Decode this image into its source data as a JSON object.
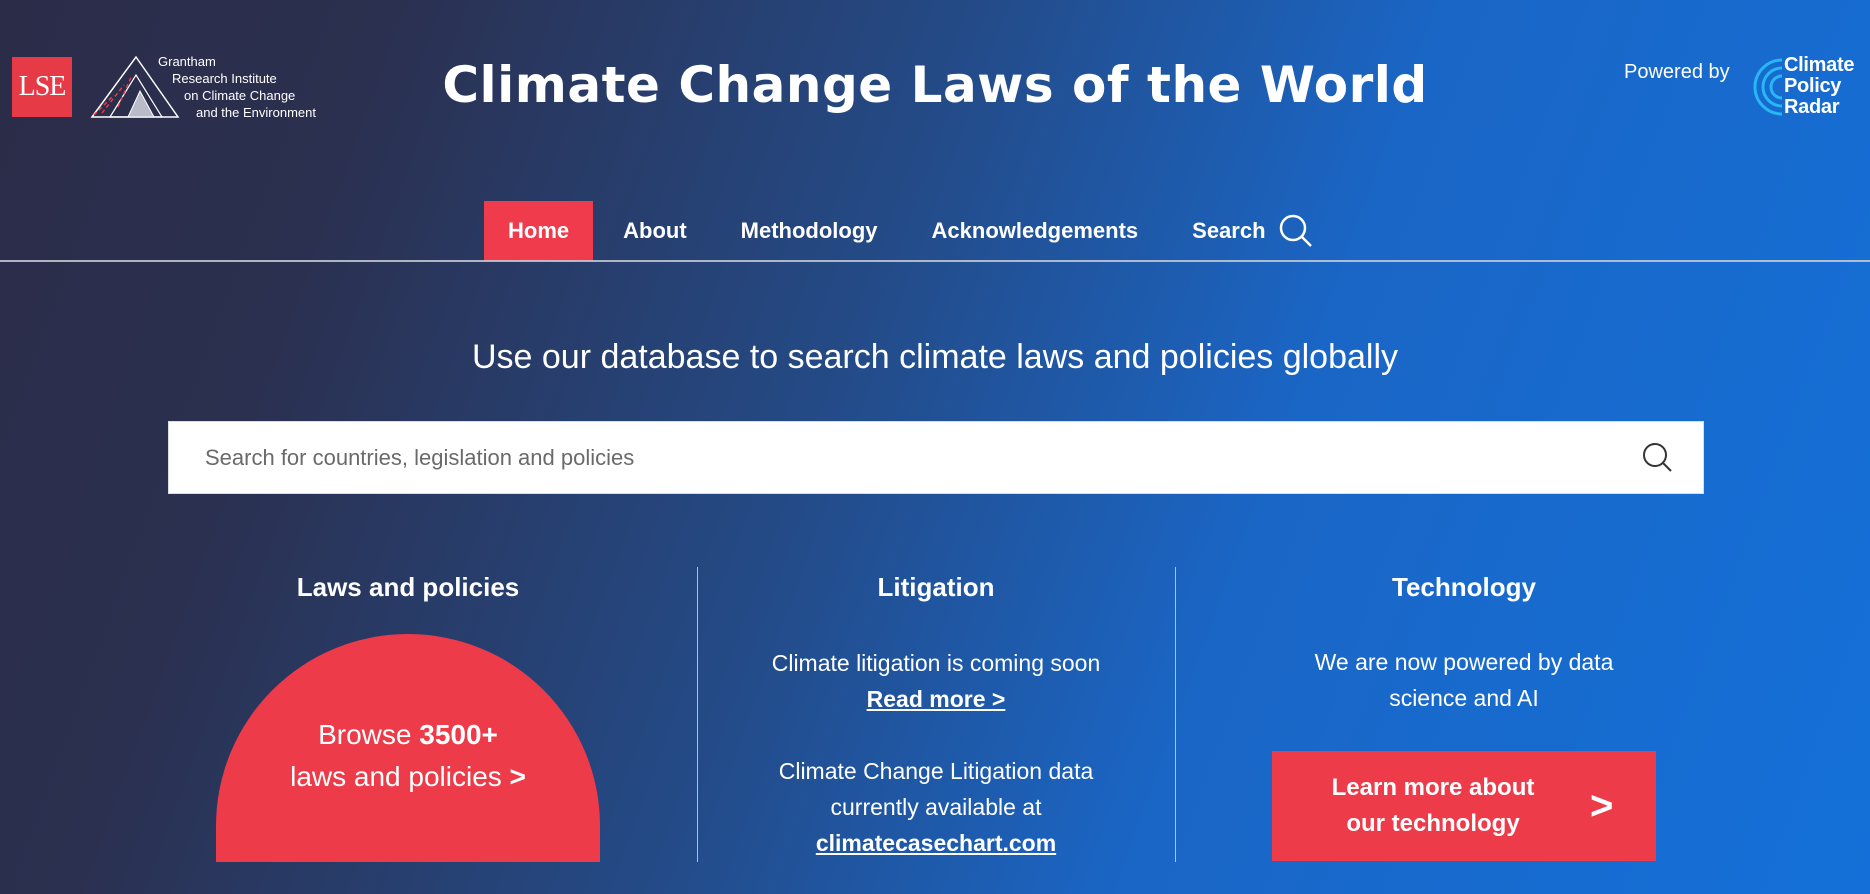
{
  "header": {
    "lse_logo_text": "LSE",
    "institute_lines": [
      "Grantham",
      "Research Institute",
      "on Climate Change",
      "and the Environment"
    ],
    "site_title": "Climate Change Laws of the World",
    "powered_by": "Powered by",
    "partner_lines": [
      "Climate",
      "Policy",
      "Radar"
    ]
  },
  "nav": {
    "items": [
      {
        "label": "Home",
        "active": true
      },
      {
        "label": "About",
        "active": false
      },
      {
        "label": "Methodology",
        "active": false
      },
      {
        "label": "Acknowledgements",
        "active": false
      },
      {
        "label": "Search",
        "active": false,
        "icon": "search-icon"
      }
    ]
  },
  "hero": {
    "tagline": "Use our database to search climate laws and policies globally",
    "search_placeholder": "Search for countries, legislation and policies",
    "search_value": ""
  },
  "columns": {
    "laws": {
      "title": "Laws and policies",
      "cta_prefix": "Browse ",
      "cta_count": "3500+",
      "cta_line2": "laws and policies ",
      "cta_chevron": ">"
    },
    "litigation": {
      "title": "Litigation",
      "coming_soon": "Climate litigation is coming soon",
      "read_more": "Read more >",
      "data_line1": "Climate Change Litigation data",
      "data_line2": "currently available at",
      "data_link": "climatecasechart.com"
    },
    "technology": {
      "title": "Technology",
      "text_line1": "We are now powered by data",
      "text_line2": "science and AI",
      "button_line1": "Learn more about",
      "button_line2": "our technology",
      "button_chevron": ">"
    }
  },
  "colors": {
    "accent_red": "#ee3b4a",
    "bg_dark": "#2b2c48",
    "bg_blue": "#1470d8",
    "cpr_cyan": "#29b6f6"
  }
}
